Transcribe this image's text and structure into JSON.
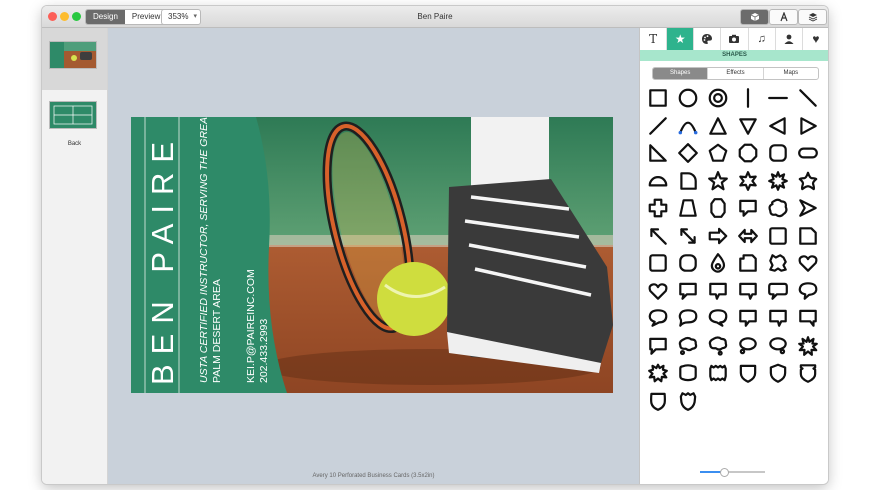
{
  "window": {
    "title": "Ben Paire",
    "mode_tabs": [
      "Design",
      "Preview"
    ],
    "zoom": "353%"
  },
  "sidebar": {
    "pages": [
      {
        "label": ""
      },
      {
        "label": "Back"
      }
    ]
  },
  "card": {
    "name": "BEN PAIRE",
    "line1": "USTA CERTIFIED INSTRUCTOR, SERVING THE GREATER",
    "line2": "PALM DESERT AREA",
    "email": "KEI.P@PAIREINC.COM",
    "phone": "202.433.2993",
    "colors": {
      "banner": "#2e8a68"
    }
  },
  "canvas": {
    "status": "Avery 10 Perforated Business Cards (3.5x2in)"
  },
  "inspector": {
    "tabs": [
      "text-icon",
      "star-icon",
      "palette-icon",
      "camera-icon",
      "music-icon",
      "person-icon",
      "heart-icon"
    ],
    "section_title": "SHAPES",
    "sub_tabs": [
      "Shapes",
      "Effects",
      "Maps"
    ],
    "accent": "#2eb38d",
    "shapes": [
      "square",
      "circle",
      "ring",
      "vertical-line",
      "horizontal-line",
      "diagonal-line",
      "line-ne",
      "curve",
      "triangle",
      "triangle-down",
      "triangle-left",
      "triangle-right",
      "right-triangle",
      "diamond",
      "pentagon",
      "octagon",
      "rounded-square",
      "pill",
      "half-circle",
      "quarter-shape",
      "star-5",
      "star-6",
      "starburst",
      "star-rounded",
      "cross",
      "trapezoid",
      "octagon-tall",
      "flag",
      "cloud-blob",
      "arrowhead",
      "arrow-nw",
      "arrow-diagonal",
      "arrow-right",
      "arrow-left-right",
      "square-2",
      "square-3",
      "frame",
      "rounded-frame",
      "drop",
      "notched-square",
      "gear-square",
      "heart",
      "heart-outline",
      "speech-bubble",
      "speech-bubble-2",
      "speech-bubble-3",
      "speech-bubble-4",
      "speech-bubble-5",
      "speech-round",
      "speech-round-2",
      "speech-round-3",
      "speech-square",
      "speech-square-2",
      "speech-square-3",
      "speech-corner",
      "thought-cloud",
      "thought-cloud-2",
      "thought-bubble",
      "thought-bubble-2",
      "burst",
      "burst-2",
      "badge",
      "badge-2",
      "shield",
      "shield-2",
      "shield-3",
      "shield-4",
      "shield-5"
    ]
  }
}
